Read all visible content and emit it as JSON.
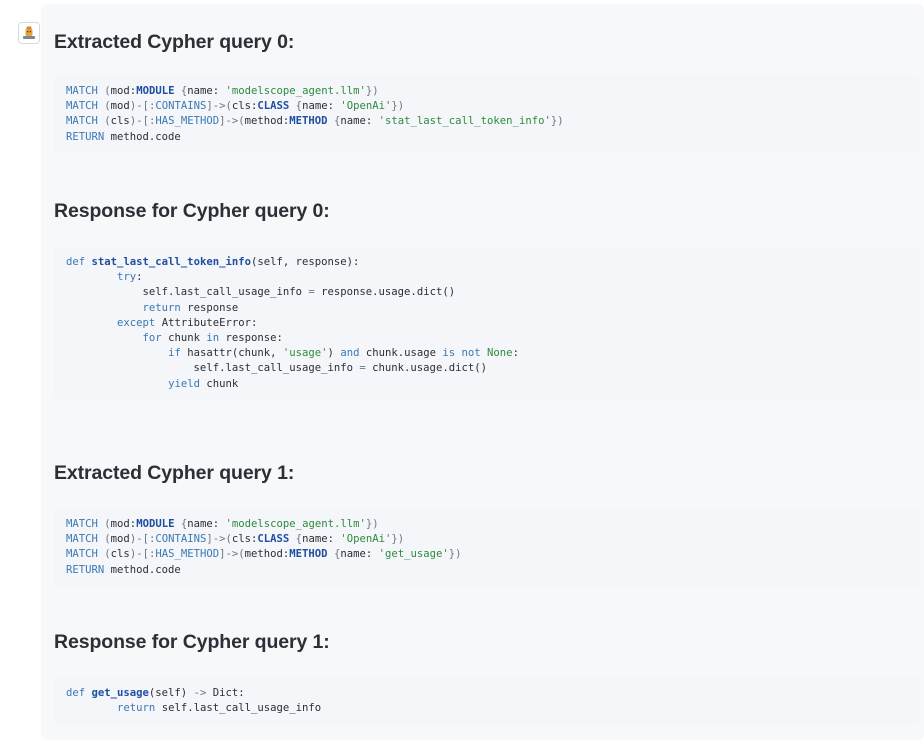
{
  "avatar": {
    "icon": "assistant-avatar-icon"
  },
  "sections": [
    {
      "heading": "Extracted Cypher query 0:",
      "lines": [
        [
          [
            "kw",
            "MATCH "
          ],
          [
            "op",
            "("
          ],
          [
            "pl",
            "mod:"
          ],
          [
            "ty",
            "MODULE"
          ],
          [
            "pl",
            " "
          ],
          [
            "op",
            "{"
          ],
          [
            "pl",
            "name: "
          ],
          [
            "str",
            "'modelscope_agent.llm'"
          ],
          [
            "op",
            "})"
          ]
        ],
        [
          [
            "kw",
            "MATCH "
          ],
          [
            "op",
            "("
          ],
          [
            "pl",
            "mod"
          ],
          [
            "op",
            ")-[:"
          ],
          [
            "kw",
            "CONTAINS"
          ],
          [
            "op",
            "]->("
          ],
          [
            "pl",
            "cls:"
          ],
          [
            "ty",
            "CLASS"
          ],
          [
            "pl",
            " "
          ],
          [
            "op",
            "{"
          ],
          [
            "pl",
            "name: "
          ],
          [
            "str",
            "'OpenAi'"
          ],
          [
            "op",
            "})"
          ]
        ],
        [
          [
            "kw",
            "MATCH "
          ],
          [
            "op",
            "("
          ],
          [
            "pl",
            "cls"
          ],
          [
            "op",
            ")-[:"
          ],
          [
            "kw",
            "HAS_METHOD"
          ],
          [
            "op",
            "]->("
          ],
          [
            "pl",
            "method:"
          ],
          [
            "ty",
            "METHOD"
          ],
          [
            "pl",
            " "
          ],
          [
            "op",
            "{"
          ],
          [
            "pl",
            "name: "
          ],
          [
            "str",
            "'stat_last_call_token_info'"
          ],
          [
            "op",
            "})"
          ]
        ],
        [
          [
            "kw",
            "RETURN "
          ],
          [
            "pl",
            "method.code"
          ]
        ]
      ]
    },
    {
      "heading": "Response for Cypher query 0:",
      "lines": [
        [
          [
            "kw",
            "def "
          ],
          [
            "fn",
            "stat_last_call_token_info"
          ],
          [
            "pl",
            "(self, response):"
          ]
        ],
        [
          [
            "pl",
            "        "
          ],
          [
            "kw",
            "try"
          ],
          [
            "pl",
            ":"
          ]
        ],
        [
          [
            "pl",
            "            self.last_call_usage_info "
          ],
          [
            "op",
            "="
          ],
          [
            "pl",
            " response.usage.dict()"
          ]
        ],
        [
          [
            "pl",
            "            "
          ],
          [
            "kw",
            "return"
          ],
          [
            "pl",
            " response"
          ]
        ],
        [
          [
            "pl",
            "        "
          ],
          [
            "kw",
            "except"
          ],
          [
            "pl",
            " AttributeError:"
          ]
        ],
        [
          [
            "pl",
            "            "
          ],
          [
            "kw",
            "for"
          ],
          [
            "pl",
            " chunk "
          ],
          [
            "kw",
            "in"
          ],
          [
            "pl",
            " response:"
          ]
        ],
        [
          [
            "pl",
            "                "
          ],
          [
            "kw",
            "if"
          ],
          [
            "pl",
            " hasattr(chunk, "
          ],
          [
            "str",
            "'usage'"
          ],
          [
            "pl",
            ") "
          ],
          [
            "kw",
            "and"
          ],
          [
            "pl",
            " chunk.usage "
          ],
          [
            "kw",
            "is not"
          ],
          [
            "pl",
            " "
          ],
          [
            "bl",
            "None"
          ],
          [
            "pl",
            ":"
          ]
        ],
        [
          [
            "pl",
            "                    self.last_call_usage_info "
          ],
          [
            "op",
            "="
          ],
          [
            "pl",
            " chunk.usage.dict()"
          ]
        ],
        [
          [
            "pl",
            "                "
          ],
          [
            "kw",
            "yield"
          ],
          [
            "pl",
            " chunk"
          ]
        ]
      ]
    },
    {
      "heading": "Extracted Cypher query 1:",
      "lines": [
        [
          [
            "kw",
            "MATCH "
          ],
          [
            "op",
            "("
          ],
          [
            "pl",
            "mod:"
          ],
          [
            "ty",
            "MODULE"
          ],
          [
            "pl",
            " "
          ],
          [
            "op",
            "{"
          ],
          [
            "pl",
            "name: "
          ],
          [
            "str",
            "'modelscope_agent.llm'"
          ],
          [
            "op",
            "})"
          ]
        ],
        [
          [
            "kw",
            "MATCH "
          ],
          [
            "op",
            "("
          ],
          [
            "pl",
            "mod"
          ],
          [
            "op",
            ")-[:"
          ],
          [
            "kw",
            "CONTAINS"
          ],
          [
            "op",
            "]->("
          ],
          [
            "pl",
            "cls:"
          ],
          [
            "ty",
            "CLASS"
          ],
          [
            "pl",
            " "
          ],
          [
            "op",
            "{"
          ],
          [
            "pl",
            "name: "
          ],
          [
            "str",
            "'OpenAi'"
          ],
          [
            "op",
            "})"
          ]
        ],
        [
          [
            "kw",
            "MATCH "
          ],
          [
            "op",
            "("
          ],
          [
            "pl",
            "cls"
          ],
          [
            "op",
            ")-[:"
          ],
          [
            "kw",
            "HAS_METHOD"
          ],
          [
            "op",
            "]->("
          ],
          [
            "pl",
            "method:"
          ],
          [
            "ty",
            "METHOD"
          ],
          [
            "pl",
            " "
          ],
          [
            "op",
            "{"
          ],
          [
            "pl",
            "name: "
          ],
          [
            "str",
            "'get_usage'"
          ],
          [
            "op",
            "})"
          ]
        ],
        [
          [
            "kw",
            "RETURN "
          ],
          [
            "pl",
            "method.code"
          ]
        ]
      ]
    },
    {
      "heading": "Response for Cypher query 1:",
      "lines": [
        [
          [
            "kw",
            "def "
          ],
          [
            "fn",
            "get_usage"
          ],
          [
            "pl",
            "(self) "
          ],
          [
            "op",
            "->"
          ],
          [
            "pl",
            " Dict:"
          ]
        ],
        [
          [
            "pl",
            "        "
          ],
          [
            "kw",
            "return"
          ],
          [
            "pl",
            " self.last_call_usage_info"
          ]
        ]
      ]
    }
  ]
}
